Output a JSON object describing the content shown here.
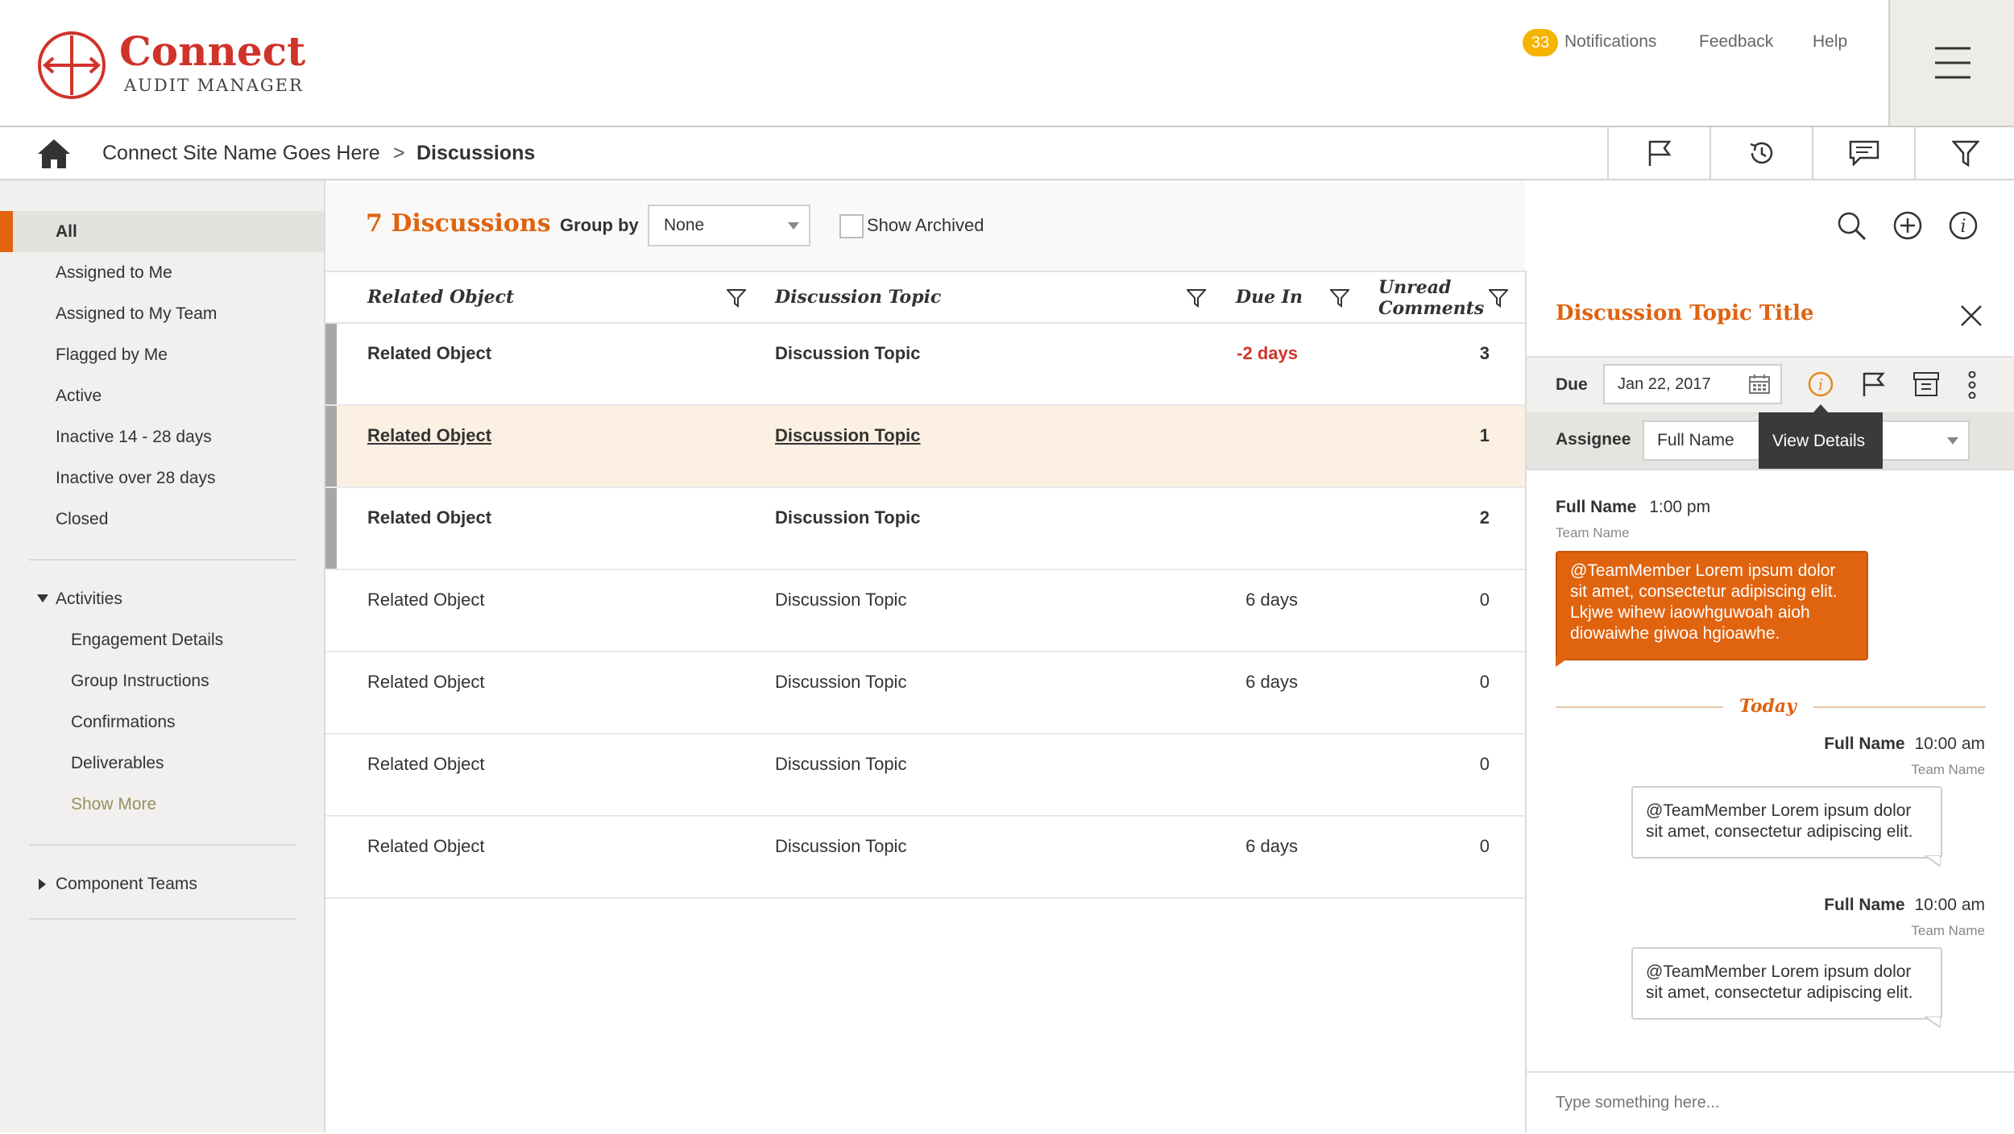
{
  "header": {
    "logo_title": "Connect",
    "logo_subtitle": "AUDIT MANAGER",
    "notifications_count": "33",
    "notifications_label": "Notifications",
    "feedback_label": "Feedback",
    "help_label": "Help",
    "accent_color": "#d0332a",
    "badge_color": "#f5b400"
  },
  "breadcrumb": {
    "site": "Connect Site Name Goes Here",
    "separator": ">",
    "current": "Discussions",
    "tools": [
      "flag-icon",
      "history-icon",
      "comment-icon",
      "filter-icon"
    ]
  },
  "sidebar": {
    "items": [
      {
        "label": "All",
        "active": true
      },
      {
        "label": "Assigned to Me"
      },
      {
        "label": "Assigned to My Team"
      },
      {
        "label": "Flagged by Me"
      },
      {
        "label": "Active"
      },
      {
        "label": "Inactive 14 - 28 days"
      },
      {
        "label": "Inactive over 28 days"
      },
      {
        "label": "Closed"
      }
    ],
    "activities": {
      "label": "Activities",
      "items": [
        "Engagement Details",
        "Group Instructions",
        "Confirmations",
        "Deliverables"
      ],
      "show_more": "Show More"
    },
    "component_teams": "Component Teams"
  },
  "main": {
    "title": "7 Discussions",
    "group_by_label": "Group by",
    "group_by_value": "None",
    "show_archived_label": "Show Archived",
    "columns": {
      "related_object": "Related Object",
      "discussion_topic": "Discussion Topic",
      "due_in": "Due In",
      "unread_line1": "Unread",
      "unread_line2": "Comments"
    },
    "rows": [
      {
        "related": "Related Object",
        "topic": "Discussion Topic",
        "due": "-2 days",
        "unread": "3"
      },
      {
        "related": "Related Object",
        "topic": "Discussion Topic",
        "due": "",
        "unread": "1"
      },
      {
        "related": "Related Object",
        "topic": "Discussion Topic",
        "due": "",
        "unread": "2"
      },
      {
        "related": "Related Object",
        "topic": "Discussion Topic",
        "due": "6 days",
        "unread": "0"
      },
      {
        "related": "Related Object",
        "topic": "Discussion Topic",
        "due": "6 days",
        "unread": "0"
      },
      {
        "related": "Related Object",
        "topic": "Discussion Topic",
        "due": "",
        "unread": "0"
      },
      {
        "related": "Related Object",
        "topic": "Discussion Topic",
        "due": "6 days",
        "unread": "0"
      }
    ]
  },
  "panel": {
    "title": "Discussion Topic Title",
    "due_label": "Due",
    "due_value": "Jan 22, 2017",
    "assignee_label": "Assignee",
    "assignee_value": "Full Name",
    "tooltip": "View Details",
    "messages": [
      {
        "name": "Full Name",
        "time": "1:00 pm",
        "team": "Team Name",
        "text": "@TeamMember Lorem ipsum dolor sit amet, consectetur adipiscing elit.  Lkjwe wihew iaowhguwoah aioh diowaiwhe giwoa hgioawhe."
      },
      {
        "name": "Full Name",
        "time": "10:00 am",
        "team": "Team Name",
        "text": "@TeamMember Lorem ipsum dolor sit amet, consectetur adipiscing elit."
      },
      {
        "name": "Full Name",
        "time": "10:00 am",
        "team": "Team Name",
        "text": "@TeamMember Lorem ipsum dolor sit amet, consectetur adipiscing elit."
      }
    ],
    "divider_label": "Today",
    "input_placeholder": "Type something here..."
  }
}
